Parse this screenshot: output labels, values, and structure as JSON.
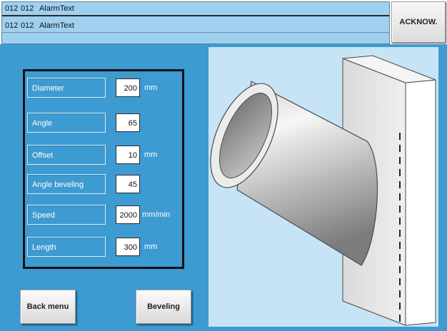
{
  "alarms": [
    {
      "code1": "012",
      "code2": "012",
      "text": "AlarmText"
    },
    {
      "code1": "012",
      "code2": "012",
      "text": "AlarmText"
    }
  ],
  "acknowledge_label": "ACKNOW.",
  "parameters": [
    {
      "label": "Diameter",
      "value": "200",
      "unit": "mm"
    },
    {
      "label": "Angle",
      "value": "65",
      "unit": ""
    },
    {
      "label": "Offset",
      "value": "10",
      "unit": "mm"
    },
    {
      "label": "Angle beveling",
      "value": "45",
      "unit": ""
    },
    {
      "label": "Speed",
      "value": "2000",
      "unit": "mm/min"
    },
    {
      "label": "Length",
      "value": "300",
      "unit": "mm"
    }
  ],
  "buttons": {
    "back_menu": "Back menu",
    "beveling": "Beveling"
  },
  "colors": {
    "panel_background": "#3d9bd2",
    "alarm_background": "#9fd0f0",
    "illustration_background": "#c6e4f5"
  }
}
